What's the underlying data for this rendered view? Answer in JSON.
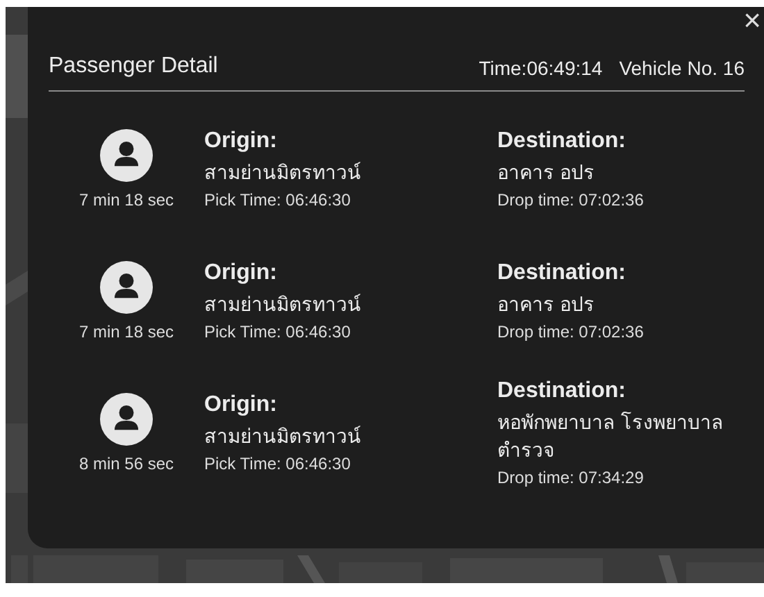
{
  "panel": {
    "title": "Passenger Detail",
    "time": "Time:06:49:14",
    "vehicle": "Vehicle No. 16",
    "close": "×"
  },
  "passengers": [
    {
      "duration": "7 min 18 sec",
      "origin_label": "Origin:",
      "origin": "สามย่านมิตรทาวน์",
      "pick_time": "Pick Time: 06:46:30",
      "destination_label": "Destination:",
      "destination": "อาคาร อปร",
      "drop_time": "Drop time: 07:02:36"
    },
    {
      "duration": "7 min 18 sec",
      "origin_label": "Origin:",
      "origin": "สามย่านมิตรทาวน์",
      "pick_time": "Pick Time: 06:46:30",
      "destination_label": "Destination:",
      "destination": "อาคาร อปร",
      "drop_time": "Drop time: 07:02:36"
    },
    {
      "duration": "8 min 56 sec",
      "origin_label": "Origin:",
      "origin": "สามย่านมิตรทาวน์",
      "pick_time": "Pick Time: 06:46:30",
      "destination_label": "Destination:",
      "destination": "หอพักพยาบาล โรงพยาบาลตำรวจ",
      "drop_time": "Drop time: 07:34:29"
    }
  ]
}
